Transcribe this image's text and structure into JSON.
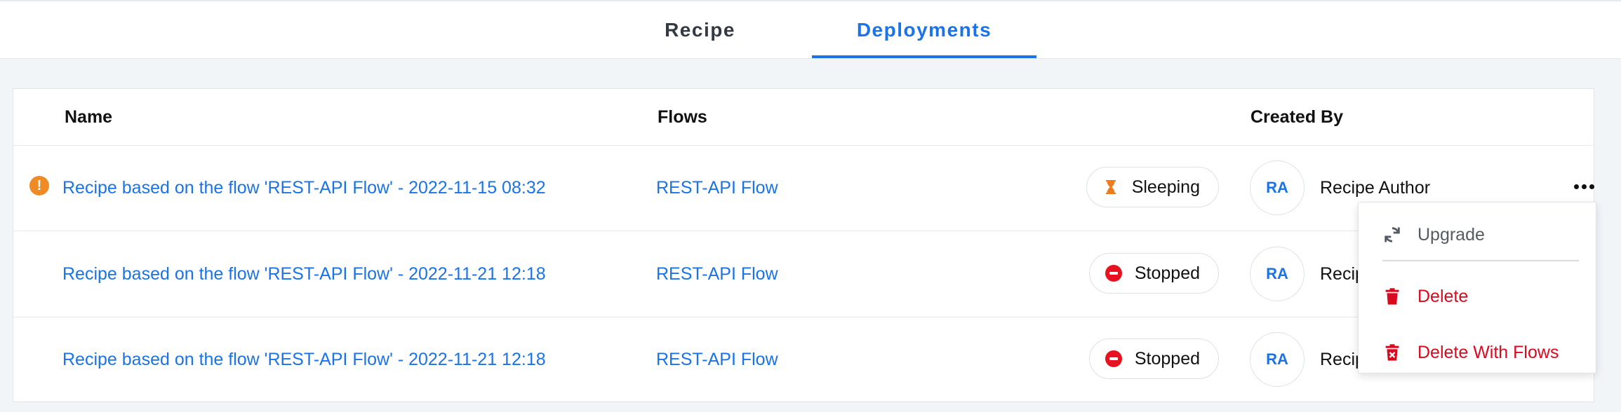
{
  "tabs": [
    {
      "label": "Recipe",
      "active": false
    },
    {
      "label": "Deployments",
      "active": true
    }
  ],
  "table": {
    "headers": {
      "name": "Name",
      "flows": "Flows",
      "created_by": "Created By"
    },
    "rows": [
      {
        "name": "Recipe based on the flow 'REST-API Flow' - 2022-11-15 08:32",
        "flow": "REST-API Flow",
        "status": "Sleeping",
        "status_icon": "hourglass-icon",
        "avatar": "RA",
        "author": "Recipe Author",
        "warning": true
      },
      {
        "name": "Recipe based on the flow 'REST-API Flow' - 2022-11-21 12:18",
        "flow": "REST-API Flow",
        "status": "Stopped",
        "status_icon": "stop-icon",
        "avatar": "RA",
        "author": "Recip",
        "warning": false
      },
      {
        "name": "Recipe based on the flow 'REST-API Flow' - 2022-11-21 12:18",
        "flow": "REST-API Flow",
        "status": "Stopped",
        "status_icon": "stop-icon",
        "avatar": "RA",
        "author": "Recip",
        "warning": false
      }
    ]
  },
  "context_menu": {
    "upgrade": "Upgrade",
    "delete": "Delete",
    "delete_with_flows": "Delete With Flows"
  },
  "colors": {
    "accent": "#1a73e8",
    "danger": "#d9091e",
    "warning": "#f08a24",
    "sleeping": "#f07b1a",
    "stopped": "#e8111f"
  },
  "warning_mark": "!"
}
